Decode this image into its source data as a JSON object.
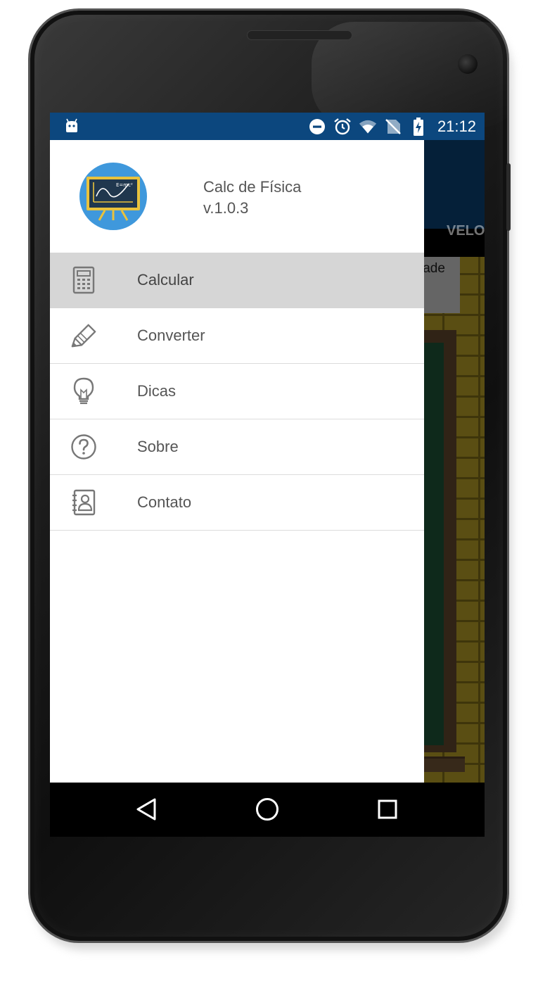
{
  "status_bar": {
    "time": "21:12",
    "icons": [
      "android-debug-icon",
      "do-not-disturb-icon",
      "alarm-icon",
      "wifi-icon",
      "no-sim-icon",
      "battery-charging-icon"
    ],
    "color": "#0c477e"
  },
  "background_app": {
    "tab_label": "VELO",
    "banner_text": "lade"
  },
  "drawer": {
    "header": {
      "app_name": "Calc de Física",
      "version": "v.1.0.3",
      "logo_icon": "physics-blackboard-icon"
    },
    "items": [
      {
        "label": "Calcular",
        "icon": "calculator-icon",
        "selected": true
      },
      {
        "label": "Converter",
        "icon": "pencil-icon",
        "selected": false
      },
      {
        "label": "Dicas",
        "icon": "lightbulb-icon",
        "selected": false
      },
      {
        "label": "Sobre",
        "icon": "help-circle-icon",
        "selected": false
      },
      {
        "label": "Contato",
        "icon": "contact-book-icon",
        "selected": false
      }
    ]
  },
  "nav_bar": {
    "buttons": [
      "back-icon",
      "home-icon",
      "recents-icon"
    ]
  }
}
